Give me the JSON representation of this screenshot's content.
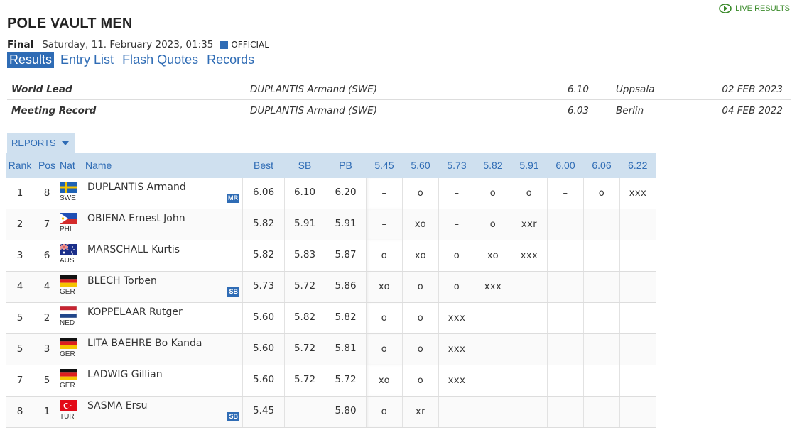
{
  "live_results": "LIVE RESULTS",
  "title": "POLE VAULT MEN",
  "round": "Final",
  "datetime": "Saturday, 11. February 2023, 01:35",
  "status": "OFFICIAL",
  "tabs": [
    "Results",
    "Entry List",
    "Flash Quotes",
    "Records"
  ],
  "records": [
    {
      "label": "World Lead",
      "name": "DUPLANTIS Armand (SWE)",
      "mark": "6.10",
      "venue": "Uppsala",
      "date": "02 FEB 2023"
    },
    {
      "label": "Meeting Record",
      "name": "DUPLANTIS Armand (SWE)",
      "mark": "6.03",
      "venue": "Berlin",
      "date": "04 FEB 2022"
    }
  ],
  "reports_label": "REPORTS",
  "headers": {
    "rank": "Rank",
    "pos": "Pos",
    "nat": "Nat",
    "name": "Name",
    "best": "Best",
    "sb": "SB",
    "pb": "PB",
    "heights": [
      "5.45",
      "5.60",
      "5.73",
      "5.82",
      "5.91",
      "6.00",
      "6.06",
      "6.22"
    ]
  },
  "rows": [
    {
      "rank": "1",
      "pos": "8",
      "nat": "SWE",
      "name": "DUPLANTIS Armand",
      "badge": "MR",
      "best": "6.06",
      "sb": "6.10",
      "pb": "6.20",
      "attempts": [
        "–",
        "o",
        "–",
        "o",
        "o",
        "–",
        "o",
        "xxx"
      ]
    },
    {
      "rank": "2",
      "pos": "7",
      "nat": "PHI",
      "name": "OBIENA Ernest John",
      "badge": "",
      "best": "5.82",
      "sb": "5.91",
      "pb": "5.91",
      "attempts": [
        "–",
        "xo",
        "–",
        "o",
        "xxr",
        "",
        "",
        ""
      ]
    },
    {
      "rank": "3",
      "pos": "6",
      "nat": "AUS",
      "name": "MARSCHALL Kurtis",
      "badge": "",
      "best": "5.82",
      "sb": "5.83",
      "pb": "5.87",
      "attempts": [
        "o",
        "xo",
        "o",
        "xo",
        "xxx",
        "",
        "",
        ""
      ]
    },
    {
      "rank": "4",
      "pos": "4",
      "nat": "GER",
      "name": "BLECH Torben",
      "badge": "SB",
      "best": "5.73",
      "sb": "5.72",
      "pb": "5.86",
      "attempts": [
        "xo",
        "o",
        "o",
        "xxx",
        "",
        "",
        "",
        ""
      ]
    },
    {
      "rank": "5",
      "pos": "2",
      "nat": "NED",
      "name": "KOPPELAAR Rutger",
      "badge": "",
      "best": "5.60",
      "sb": "5.82",
      "pb": "5.82",
      "attempts": [
        "o",
        "o",
        "xxx",
        "",
        "",
        "",
        "",
        ""
      ]
    },
    {
      "rank": "5",
      "pos": "3",
      "nat": "GER",
      "name": "LITA BAEHRE Bo Kanda",
      "badge": "",
      "best": "5.60",
      "sb": "5.72",
      "pb": "5.81",
      "attempts": [
        "o",
        "o",
        "xxx",
        "",
        "",
        "",
        "",
        ""
      ]
    },
    {
      "rank": "7",
      "pos": "5",
      "nat": "GER",
      "name": "LADWIG Gillian",
      "badge": "",
      "best": "5.60",
      "sb": "5.72",
      "pb": "5.72",
      "attempts": [
        "xo",
        "o",
        "xxx",
        "",
        "",
        "",
        "",
        ""
      ]
    },
    {
      "rank": "8",
      "pos": "1",
      "nat": "TUR",
      "name": "SASMA Ersu",
      "badge": "SB",
      "best": "5.45",
      "sb": "",
      "pb": "5.80",
      "attempts": [
        "o",
        "xr",
        "",
        "",
        "",
        "",
        "",
        ""
      ]
    }
  ],
  "colors": {
    "accent": "#2f6cb5",
    "header_bg": "#cfe0ef",
    "live": "#3a8a2a"
  }
}
